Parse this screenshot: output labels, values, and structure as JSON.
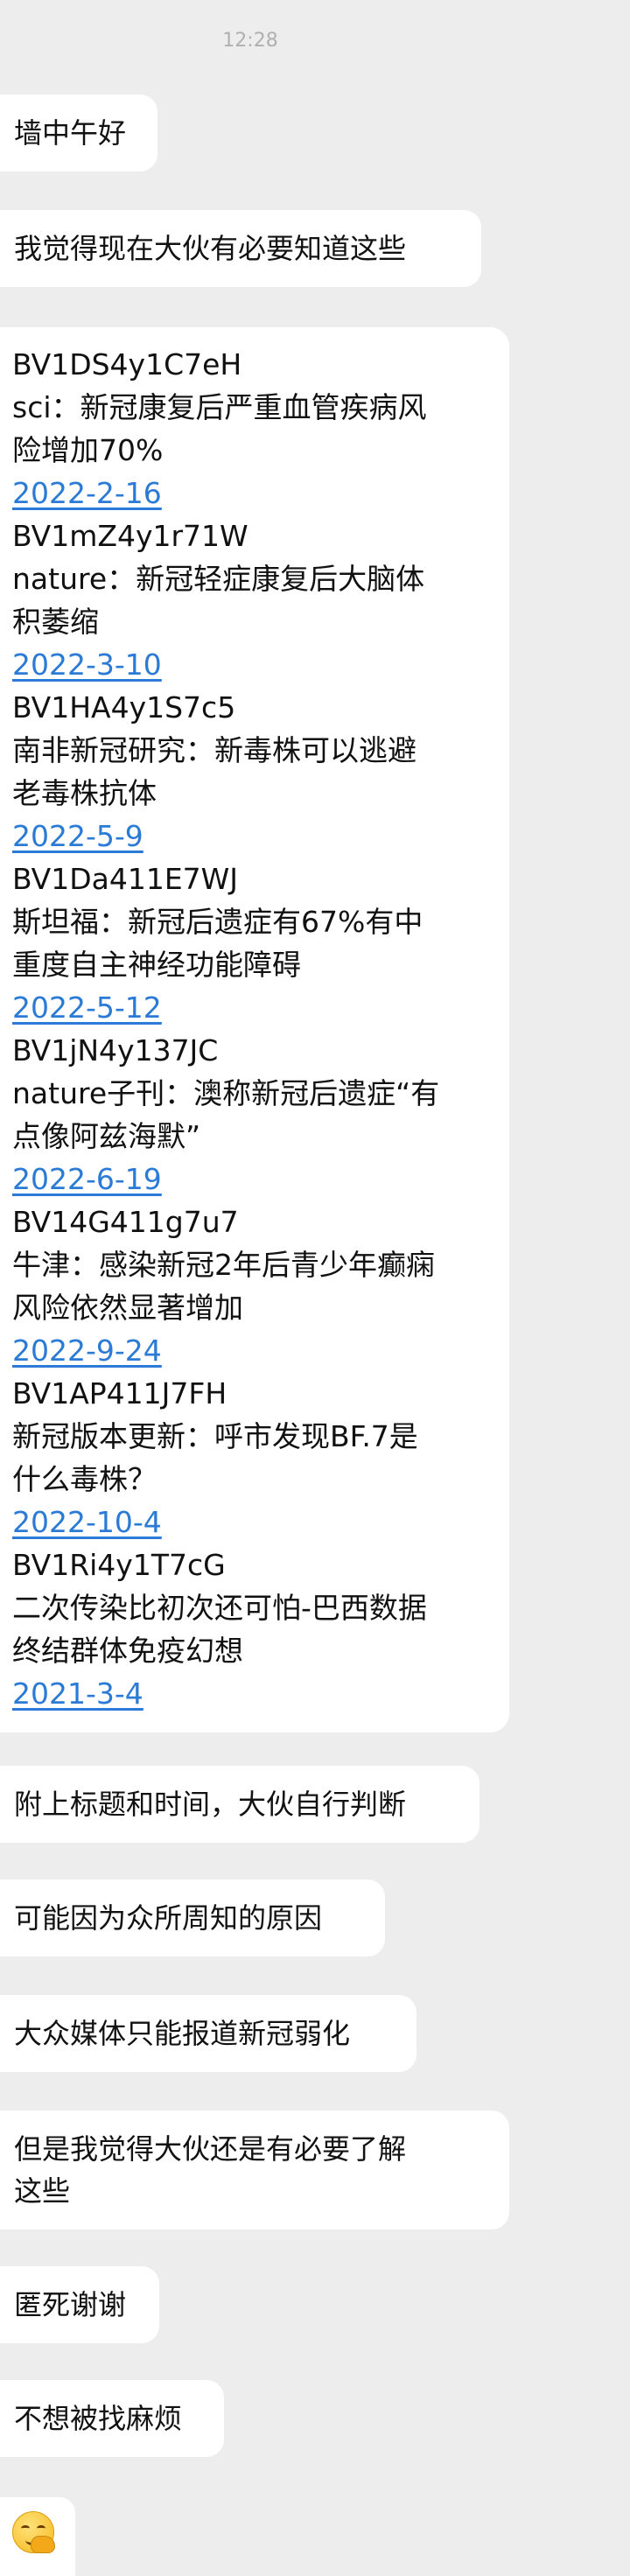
{
  "status_bar": {
    "time": "12:28"
  },
  "messages": {
    "m1": "墙中午好",
    "m2": "我觉得现在大伙有必要知道这些",
    "m4": "附上标题和时间，大伙自行判断",
    "m5": "可能因为众所周知的原因",
    "m6": "大众媒体只能报道新冠弱化",
    "m7_line1": "但是我觉得大伙还是有必要了解",
    "m7_line2": "这些",
    "m8": "匿死谢谢",
    "m9": "不想被找麻烦"
  },
  "entries": [
    {
      "id": "BV1DS4y1C7eH",
      "title_lines": [
        "sci：新冠康复后严重血管疾病风",
        "险增加70%"
      ],
      "date": "2022-2-16"
    },
    {
      "id": "BV1mZ4y1r71W",
      "title_lines": [
        "nature：新冠轻症康复后大脑体",
        "积萎缩"
      ],
      "date": "2022-3-10"
    },
    {
      "id": "BV1HA4y1S7c5",
      "title_lines": [
        "南非新冠研究：新毒株可以逃避",
        "老毒株抗体"
      ],
      "date": "2022-5-9"
    },
    {
      "id": "BV1Da411E7WJ",
      "title_lines": [
        "斯坦福：新冠后遗症有67%有中",
        "重度自主神经功能障碍"
      ],
      "date": "2022-5-12"
    },
    {
      "id": "BV1jN4y137JC",
      "title_lines": [
        "nature子刊：澳称新冠后遗症“有",
        "点像阿兹海默”"
      ],
      "date": "2022-6-19"
    },
    {
      "id": "BV14G411g7u7",
      "title_lines": [
        "牛津：感染新冠2年后青少年癫痫",
        "风险依然显著增加"
      ],
      "date": "2022-9-24"
    },
    {
      "id": "BV1AP411J7FH",
      "title_lines": [
        "新冠版本更新：呼市发现BF.7是",
        "什么毒株？"
      ],
      "date": "2022-10-4"
    },
    {
      "id": "BV1Ri4y1T7cG",
      "title_lines": [
        "二次传染比初次还可怕-巴西数据",
        "终结群体免疫幻想"
      ],
      "date": "2021-3-4"
    }
  ],
  "emoji": {
    "icon": "hand-over-mouth-emoji"
  },
  "colors": {
    "background": "#ededed",
    "bubble": "#ffffff",
    "link": "#2b7bd6"
  }
}
